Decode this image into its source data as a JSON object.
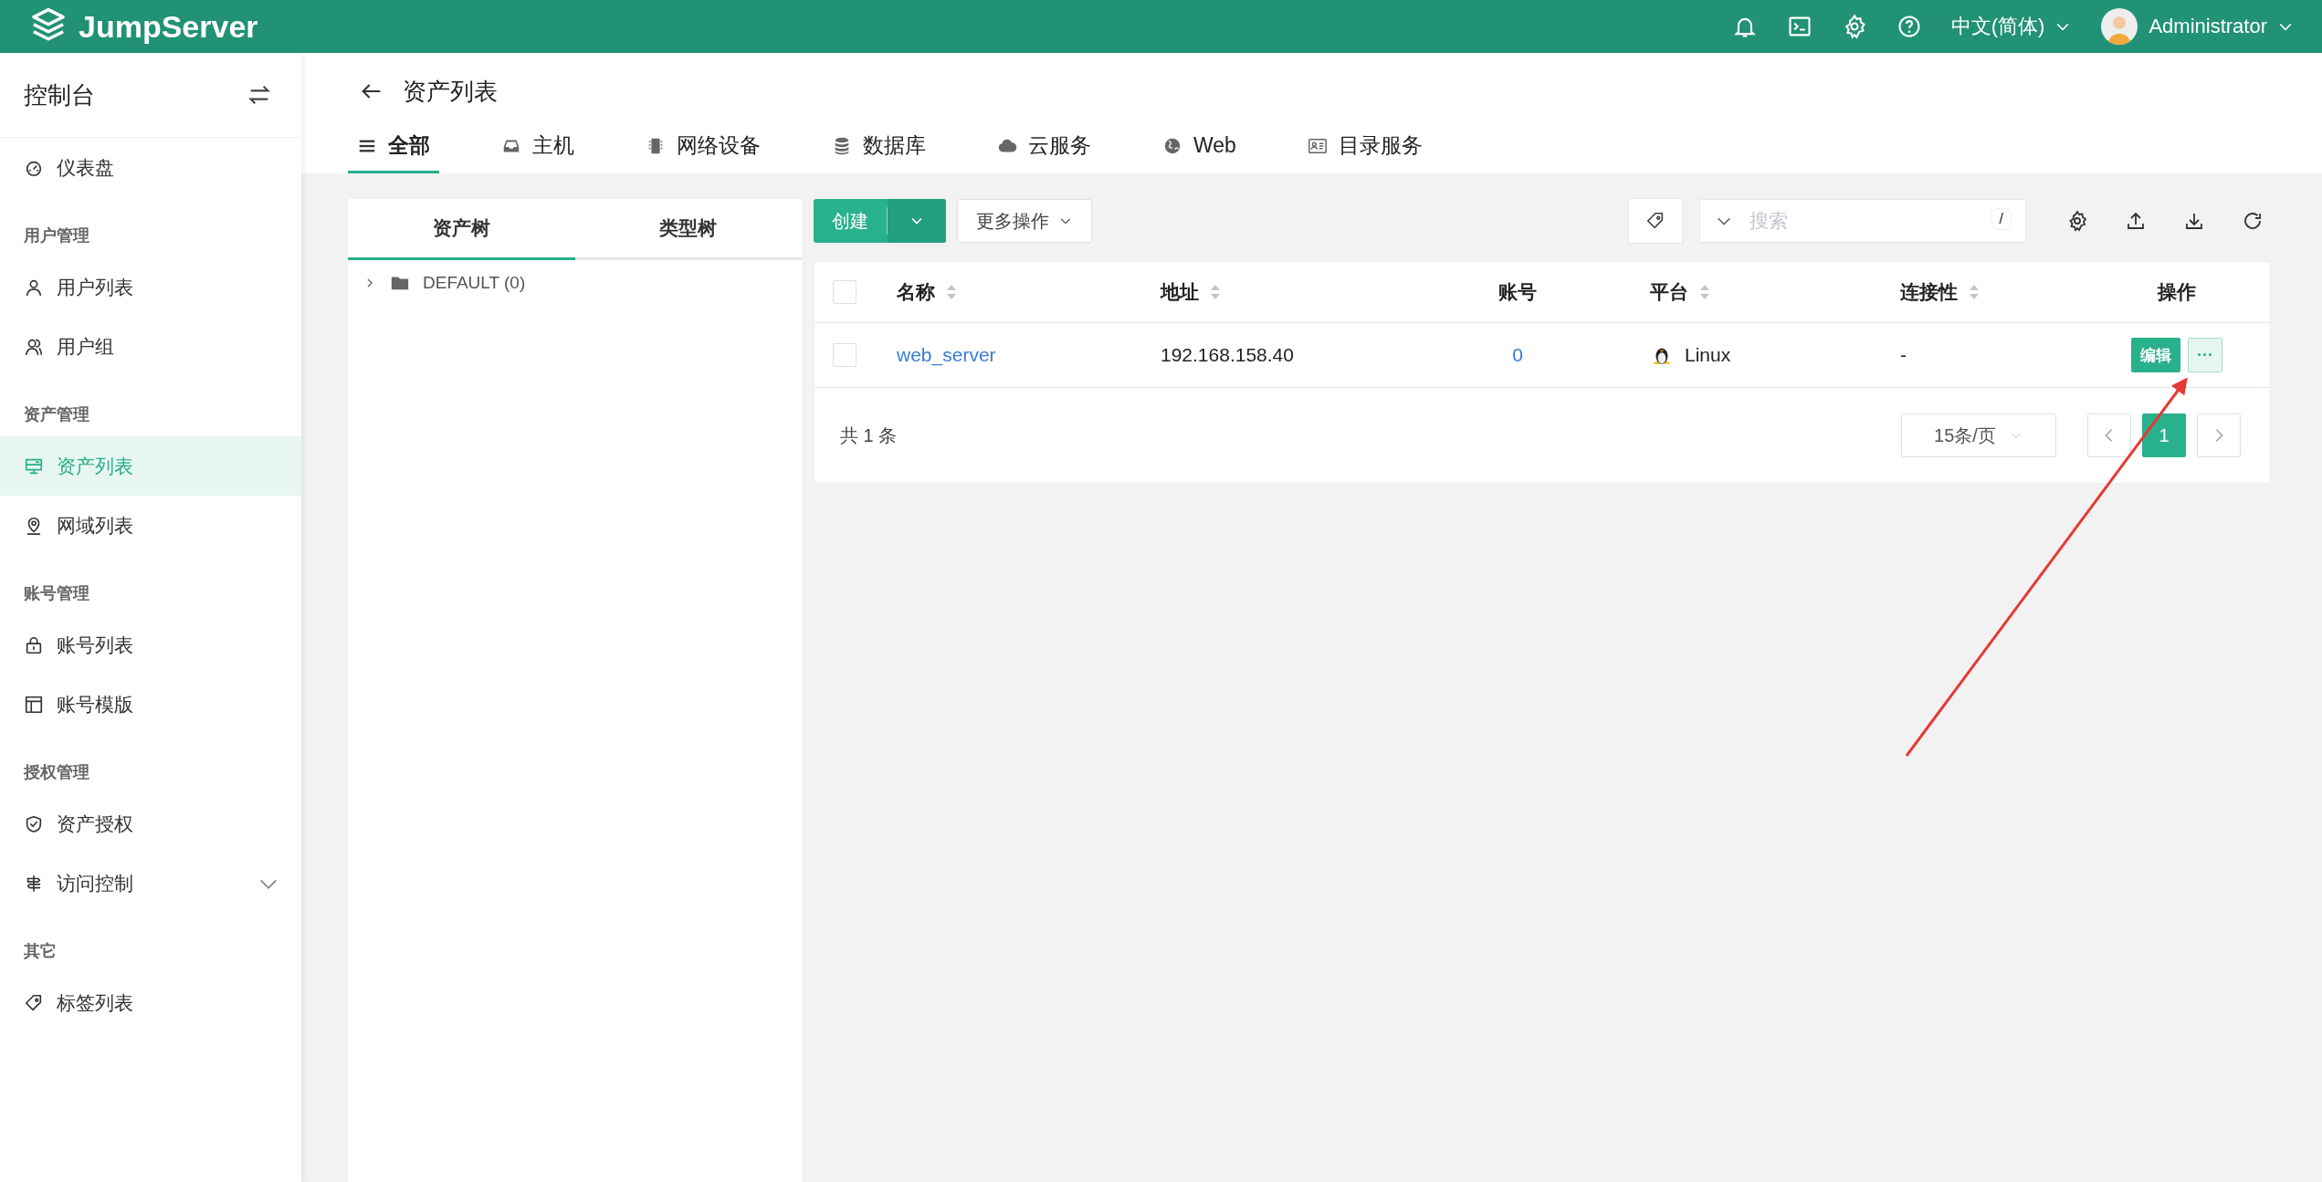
{
  "header": {
    "brand": "JumpServer",
    "language": "中文(简体)",
    "user": "Administrator"
  },
  "sidebar": {
    "title": "控制台",
    "items": [
      {
        "kind": "item",
        "label": "仪表盘",
        "selected": false
      },
      {
        "kind": "section",
        "label": "用户管理"
      },
      {
        "kind": "item",
        "label": "用户列表",
        "selected": false
      },
      {
        "kind": "item",
        "label": "用户组",
        "selected": false
      },
      {
        "kind": "section",
        "label": "资产管理"
      },
      {
        "kind": "item",
        "label": "资产列表",
        "selected": true
      },
      {
        "kind": "item",
        "label": "网域列表",
        "selected": false
      },
      {
        "kind": "section",
        "label": "账号管理"
      },
      {
        "kind": "item",
        "label": "账号列表",
        "selected": false
      },
      {
        "kind": "item",
        "label": "账号模版",
        "selected": false
      },
      {
        "kind": "section",
        "label": "授权管理"
      },
      {
        "kind": "item",
        "label": "资产授权",
        "selected": false
      },
      {
        "kind": "item",
        "label": "访问控制",
        "selected": false,
        "expanded": false
      },
      {
        "kind": "section",
        "label": "其它"
      },
      {
        "kind": "item",
        "label": "标签列表",
        "selected": false
      }
    ]
  },
  "page": {
    "title": "资产列表",
    "tabs": [
      {
        "label": "全部",
        "selected": true
      },
      {
        "label": "主机",
        "selected": false
      },
      {
        "label": "网络设备",
        "selected": false
      },
      {
        "label": "数据库",
        "selected": false
      },
      {
        "label": "云服务",
        "selected": false
      },
      {
        "label": "Web",
        "selected": false
      },
      {
        "label": "目录服务",
        "selected": false
      }
    ]
  },
  "tree": {
    "tabs": [
      {
        "label": "资产树",
        "selected": true
      },
      {
        "label": "类型树",
        "selected": false
      }
    ],
    "nodes": [
      {
        "label": "DEFAULT (0)",
        "expanded": false
      }
    ]
  },
  "toolbar": {
    "create": "创建",
    "more": "更多操作",
    "search": {
      "placeholder": "搜索",
      "shortcut": "/"
    }
  },
  "table": {
    "select_all_checked": false,
    "columns": [
      {
        "label": "名称",
        "sortable": true
      },
      {
        "label": "地址",
        "sortable": true
      },
      {
        "label": "账号",
        "sortable": false
      },
      {
        "label": "平台",
        "sortable": true
      },
      {
        "label": "连接性",
        "sortable": true
      },
      {
        "label": "操作",
        "sortable": false
      }
    ],
    "rows": [
      {
        "checked": false,
        "name": "web_server",
        "address": "192.168.158.40",
        "accounts": "0",
        "platform": "Linux",
        "connectivity": "-",
        "edit": "编辑",
        "more": "···"
      }
    ]
  },
  "pagination": {
    "total": "共 1 条",
    "page_size": "15条/页",
    "pages": [
      {
        "label": "1",
        "selected": true
      }
    ]
  }
}
